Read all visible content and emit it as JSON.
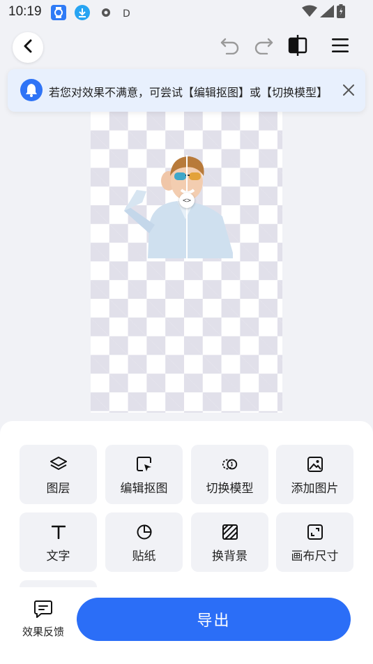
{
  "status_bar": {
    "time": "10:19",
    "indicator": "D",
    "icons": [
      "watch-icon",
      "download-icon",
      "gear-icon",
      "wifi-icon",
      "signal-icon",
      "battery-icon"
    ]
  },
  "toolbar": {
    "icons": [
      "back-arrow-icon",
      "undo-icon",
      "redo-icon",
      "compare-icon",
      "menu-icon"
    ]
  },
  "notice": {
    "text": "若您对效果不满意，可尝试【编辑抠图】或【切换模型】",
    "icons": [
      "bell-icon",
      "close-icon"
    ]
  },
  "canvas": {
    "compare_handle": "<>"
  },
  "tools": [
    {
      "label": "图层",
      "icon": "layers-icon"
    },
    {
      "label": "编辑抠图",
      "icon": "edit-cutout-icon"
    },
    {
      "label": "切换模型",
      "icon": "switch-model-icon"
    },
    {
      "label": "添加图片",
      "icon": "image-icon"
    },
    {
      "label": "文字",
      "icon": "text-icon"
    },
    {
      "label": "贴纸",
      "icon": "sticker-icon"
    },
    {
      "label": "换背景",
      "icon": "background-icon"
    },
    {
      "label": "画布尺寸",
      "icon": "canvas-size-icon"
    }
  ],
  "footer": {
    "feedback_label": "效果反馈",
    "export_label": "导出"
  },
  "colors": {
    "accent": "#2b6ef7",
    "notice_bg": "#e8f0fd",
    "tile_bg": "#f1f2f6"
  }
}
